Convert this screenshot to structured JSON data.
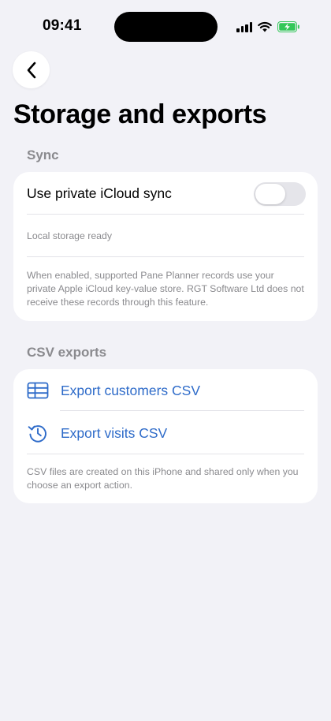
{
  "status_bar": {
    "time": "09:41"
  },
  "nav": {
    "back_icon": "chevron-left-icon"
  },
  "page": {
    "title": "Storage and exports"
  },
  "sync": {
    "header": "Sync",
    "toggle_label": "Use private iCloud sync",
    "toggle_on": false,
    "status_text": "Local storage ready",
    "description": "When enabled, supported Pane Planner records use your private Apple iCloud key-value store. RGT Software Ltd does not receive these records through this feature."
  },
  "exports": {
    "header": "CSV exports",
    "items": [
      {
        "label": "Export customers CSV",
        "icon": "table-icon"
      },
      {
        "label": "Export visits CSV",
        "icon": "history-icon"
      }
    ],
    "footnote": "CSV files are created on this iPhone and shared only when you choose an export action."
  },
  "colors": {
    "background": "#f2f2f7",
    "accent": "#2e6bc9",
    "battery": "#34c759"
  }
}
